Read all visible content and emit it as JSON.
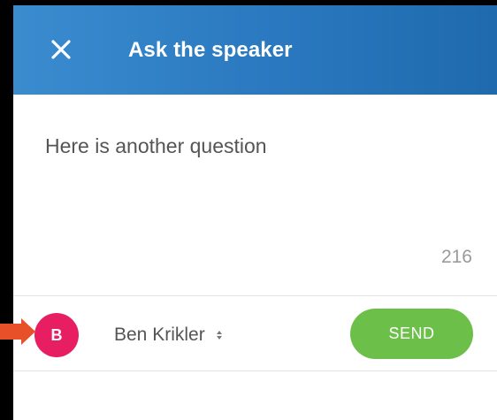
{
  "header": {
    "close_icon": "close-icon",
    "title": "Ask the speaker"
  },
  "question": {
    "text": "Here is another question",
    "remaining_chars": "216"
  },
  "footer": {
    "avatar_initial": "B",
    "user_name": "Ben Krikler",
    "select_icon": "updown-icon",
    "send_label": "SEND"
  },
  "colors": {
    "header_blue": "#2a78bf",
    "avatar_pink": "#e81e63",
    "send_green": "#6cc04a",
    "annotation_arrow": "#e8502a"
  }
}
